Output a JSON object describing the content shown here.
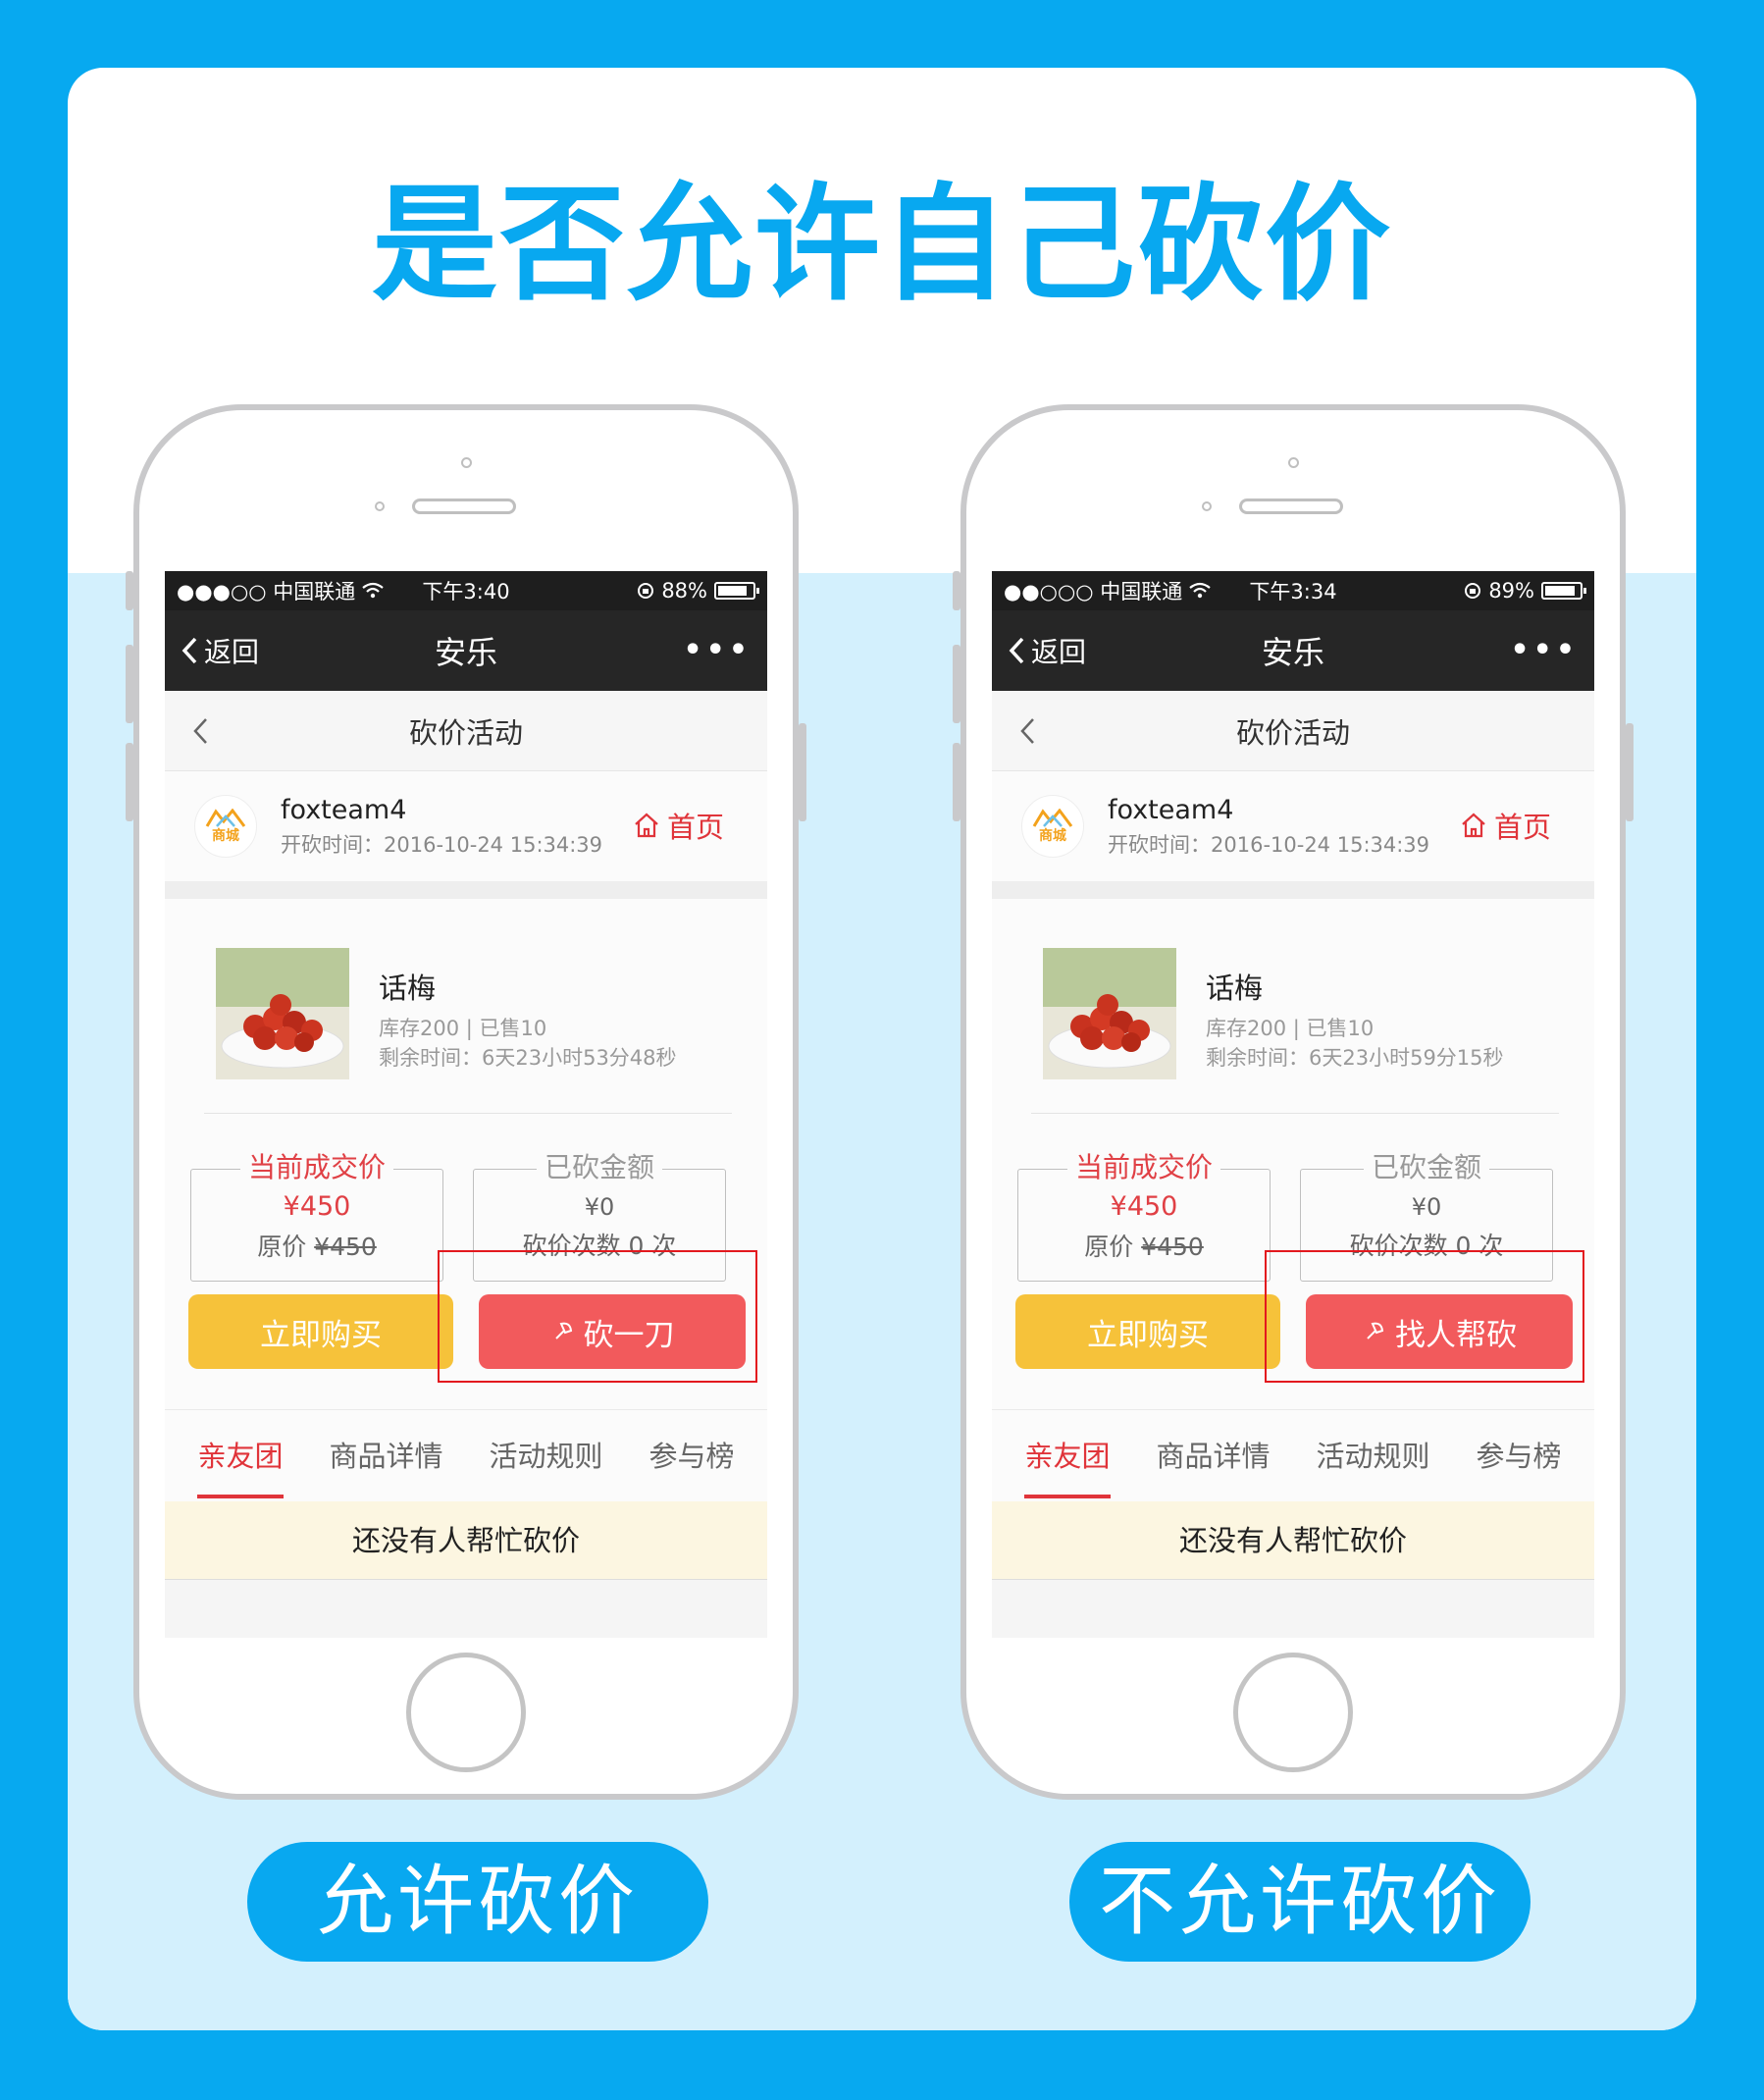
{
  "headline": "是否允许自己砍价",
  "colors": {
    "background": "#07a9f0",
    "accent": "#08a8f0",
    "red": "#e0343a",
    "yellow": "#f6c23a"
  },
  "phones": [
    {
      "status": {
        "carrier": "●●●○○ 中国联通",
        "time": "下午3:40",
        "battery": "88%",
        "battery_level": 0.88
      },
      "nav": {
        "back": "返回",
        "title": "安乐",
        "more": "•••"
      },
      "subnav_title": "砍价活动",
      "shop": {
        "name": "foxteam4",
        "logo_text": "商城",
        "start_time": "开砍时间：2016-10-24 15:34:39",
        "home_label": "首页"
      },
      "product": {
        "name": "话梅",
        "stock": "库存200 | 已售10",
        "remaining": "剩余时间：6天23小时53分48秒",
        "current_label": "当前成交价",
        "current_price": "¥450",
        "original_label": "原价",
        "original_price": "¥450",
        "cut_label": "已砍金额",
        "cut_amount": "¥0",
        "cut_count": "砍价次数 0 次"
      },
      "buy_button": "立即购买",
      "cut_button": "砍一刀",
      "tabs": [
        "亲友团",
        "商品详情",
        "活动规则",
        "参与榜"
      ],
      "notice": "还没有人帮忙砍价",
      "caption": "允许砍价"
    },
    {
      "status": {
        "carrier": "●●○○○ 中国联通",
        "time": "下午3:34",
        "battery": "89%",
        "battery_level": 0.89
      },
      "nav": {
        "back": "返回",
        "title": "安乐",
        "more": "•••"
      },
      "subnav_title": "砍价活动",
      "shop": {
        "name": "foxteam4",
        "logo_text": "商城",
        "start_time": "开砍时间：2016-10-24 15:34:39",
        "home_label": "首页"
      },
      "product": {
        "name": "话梅",
        "stock": "库存200 | 已售10",
        "remaining": "剩余时间：6天23小时59分15秒",
        "current_label": "当前成交价",
        "current_price": "¥450",
        "original_label": "原价",
        "original_price": "¥450",
        "cut_label": "已砍金额",
        "cut_amount": "¥0",
        "cut_count": "砍价次数 0 次"
      },
      "buy_button": "立即购买",
      "cut_button": "找人帮砍",
      "tabs": [
        "亲友团",
        "商品详情",
        "活动规则",
        "参与榜"
      ],
      "notice": "还没有人帮忙砍价",
      "caption": "不允许砍价"
    }
  ]
}
